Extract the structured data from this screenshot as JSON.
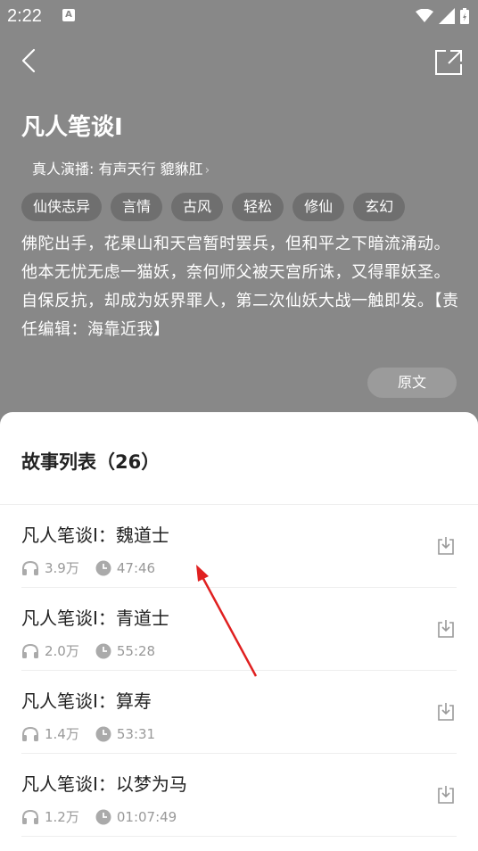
{
  "status_bar": {
    "time": "2:22",
    "badge": "A"
  },
  "header": {
    "title": "凡人笔谈Ⅰ",
    "performer_label": "真人演播:",
    "performer_names": "有声天行 貔貅肛",
    "tags": [
      "仙侠志异",
      "言情",
      "古风",
      "轻松",
      "修仙",
      "玄幻"
    ],
    "description": "佛陀出手，花果山和天宫暂时罢兵，但和平之下暗流涌动。他本无忧无虑一猫妖，奈何师父被天宫所诛，又得罪妖圣。自保反抗，却成为妖界罪人，第二次仙妖大战一触即发。【责任编辑：海靠近我】",
    "original_button": "原文"
  },
  "story_list": {
    "title": "故事列表（26）",
    "episodes": [
      {
        "title": "凡人笔谈Ⅰ：魏道士",
        "plays": "3.9万",
        "duration": "47:46"
      },
      {
        "title": "凡人笔谈Ⅰ：青道士",
        "plays": "2.0万",
        "duration": "55:28"
      },
      {
        "title": "凡人笔谈Ⅰ：算寿",
        "plays": "1.4万",
        "duration": "53:31"
      },
      {
        "title": "凡人笔谈Ⅰ：以梦为马",
        "plays": "1.2万",
        "duration": "01:07:49"
      }
    ]
  },
  "colors": {
    "overlay": "#888888",
    "accent_arrow": "#e02020",
    "meta_gray": "#999999"
  }
}
